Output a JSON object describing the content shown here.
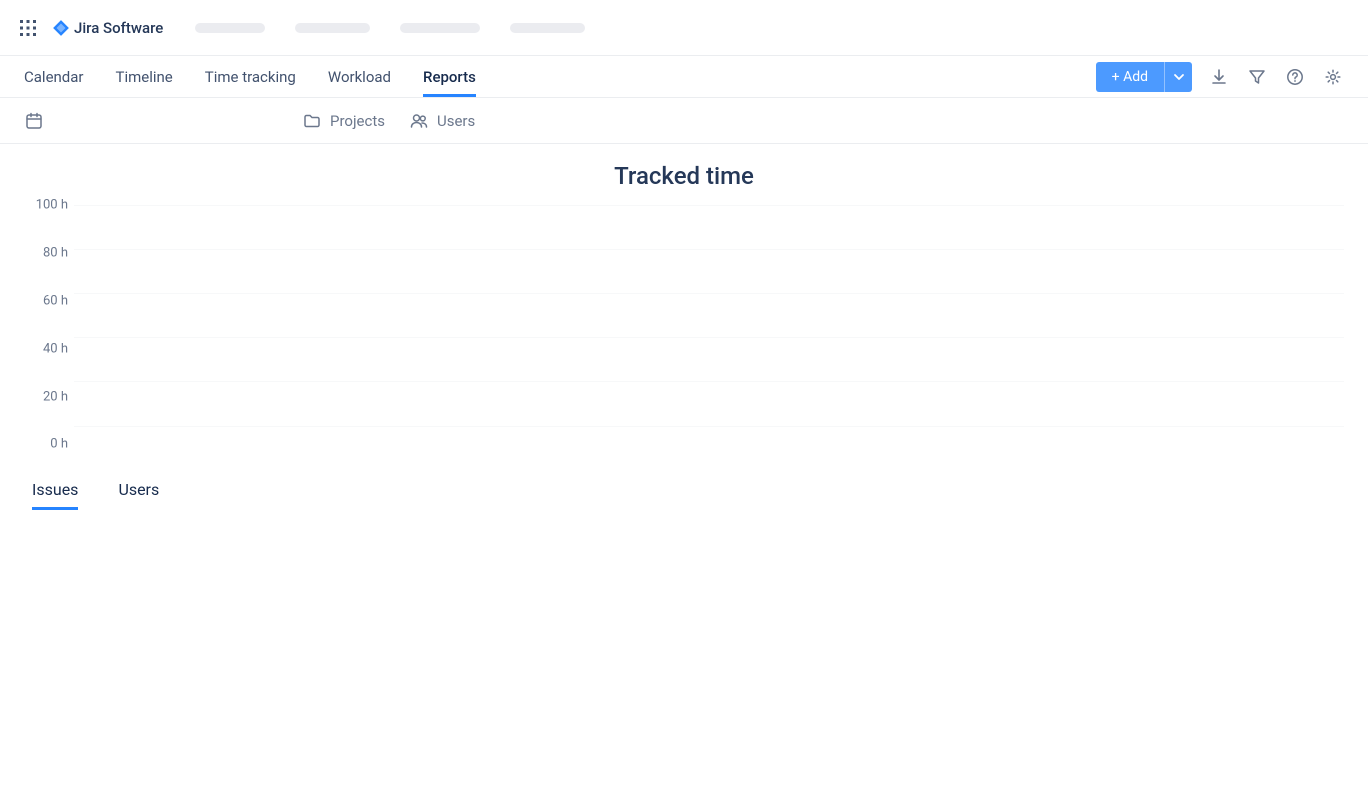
{
  "app": {
    "product_name": "Jira Software"
  },
  "main_tabs": {
    "items": [
      {
        "label": "Calendar"
      },
      {
        "label": "Timeline"
      },
      {
        "label": "Time tracking"
      },
      {
        "label": "Workload"
      },
      {
        "label": "Reports"
      }
    ],
    "active_index": 4
  },
  "actions": {
    "add_label": "+ Add"
  },
  "filters": {
    "projects_label": "Projects",
    "users_label": "Users"
  },
  "sub_tabs": {
    "items": [
      {
        "label": "Issues"
      },
      {
        "label": "Users"
      }
    ],
    "active_index": 0
  },
  "chart_data": {
    "type": "bar",
    "title": "Tracked time",
    "xlabel": "",
    "ylabel": "",
    "categories": [],
    "values": [],
    "y_ticks": [
      "100 h",
      "80 h",
      "60 h",
      "40 h",
      "20 h",
      "0 h"
    ],
    "ylim": [
      0,
      100
    ]
  }
}
